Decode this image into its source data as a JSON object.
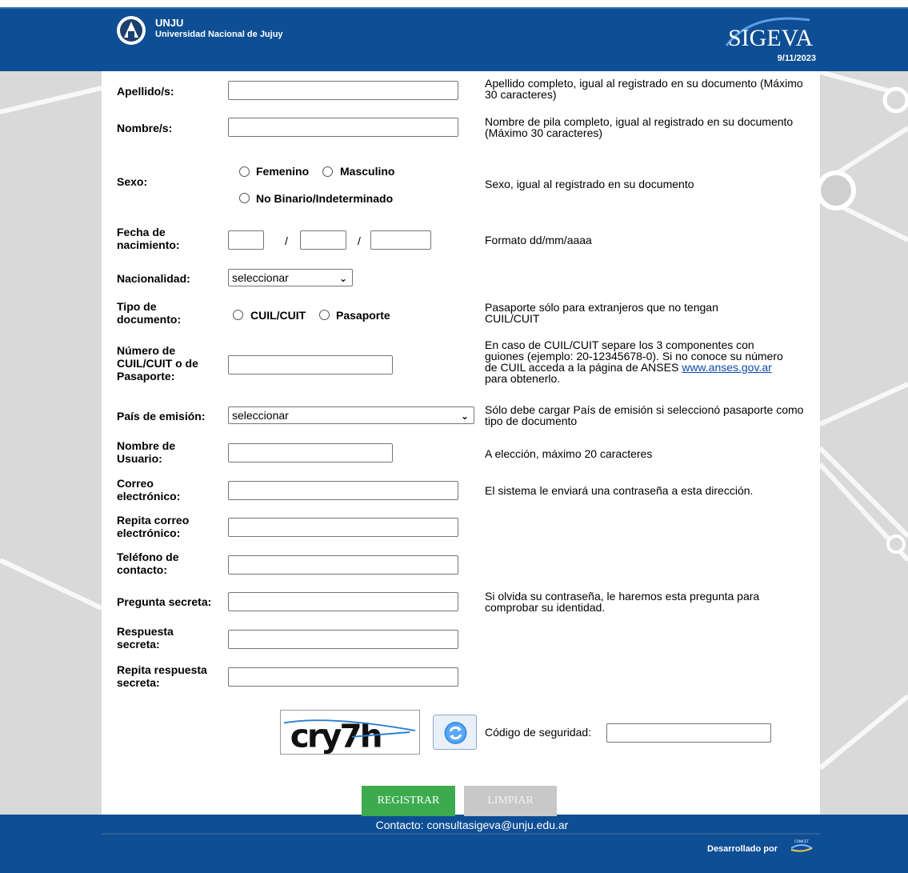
{
  "header": {
    "abbr": "UNJU",
    "university": "Universidad Nacional de Jujuy",
    "logo_text": "SIGEVA",
    "date": "9/11/2023",
    "colors": {
      "bar": "#0e4e94",
      "accent": "#3cab4e"
    }
  },
  "form": {
    "apellidos": {
      "label": "Apellido/s:",
      "value": "",
      "help": "Apellido completo, igual al registrado en su documento (Máximo 30 caracteres)"
    },
    "nombres": {
      "label": "Nombre/s:",
      "value": "",
      "help": "Nombre de pila completo, igual al registrado en su documento (Máximo 30 caracteres)"
    },
    "sexo": {
      "label": "Sexo:",
      "options": [
        "Femenino",
        "Masculino",
        "No Binario/Indeterminado"
      ],
      "selected": null,
      "help": "Sexo, igual al registrado en su documento"
    },
    "fecha": {
      "label_line1": "Fecha de",
      "label_line2": "nacimiento:",
      "separator": "/",
      "help": "Formato dd/mm/aaaa"
    },
    "nacionalidad": {
      "label": "Nacionalidad:",
      "selected": "seleccionar"
    },
    "tipo_documento": {
      "label_line1": "Tipo de",
      "label_line2": "documento:",
      "options": [
        "CUIL/CUIT",
        "Pasaporte"
      ],
      "help": "Pasaporte sólo para extranjeros que no tengan CUIL/CUIT"
    },
    "numero": {
      "label_line1": "Número de",
      "label_line2": "CUIL/CUIT o de",
      "label_line3": "Pasaporte:",
      "help_text": "En caso de CUIL/CUIT separe los 3 componentes con guiones (ejemplo: 20-12345678-0). Si no conoce su número de CUIL acceda a la página de ANSES",
      "help_link": "www.anses.gov.ar",
      "help_suffix": "para obtenerlo."
    },
    "pais_emision": {
      "label": "País de emisión:",
      "selected": "seleccionar",
      "help": "Sólo debe cargar País de emisión si seleccionó pasaporte como tipo de documento"
    },
    "usuario": {
      "label_line1": "Nombre de",
      "label_line2": "Usuario:",
      "help": "A elección, máximo 20 caracteres"
    },
    "correo": {
      "label_line1": "Correo",
      "label_line2": "electrónico:",
      "help": "El sistema le enviará una contraseña a esta dirección."
    },
    "correo_repite": {
      "label_line1": "Repita correo",
      "label_line2": "electrónico:"
    },
    "telefono": {
      "label_line1": "Teléfono de",
      "label_line2": "contacto:"
    },
    "pregunta": {
      "label": "Pregunta secreta:",
      "help": "Si olvida su contraseña, le haremos esta pregunta para comprobar su identidad."
    },
    "respuesta": {
      "label_line1": "Respuesta",
      "label_line2": "secreta:"
    },
    "respuesta_repite": {
      "label_line1": "Repita respuesta",
      "label_line2": "secreta:"
    },
    "captcha": {
      "text": "cry7h",
      "code_label": "Código de seguridad:"
    }
  },
  "buttons": {
    "register": "REGISTRAR",
    "clear": "LIMPIAR"
  },
  "footer": {
    "contact": "Contacto: consultasigeva@unju.edu.ar",
    "developed_by": "Desarrollado por",
    "dev_logo_text": "CONICET"
  }
}
